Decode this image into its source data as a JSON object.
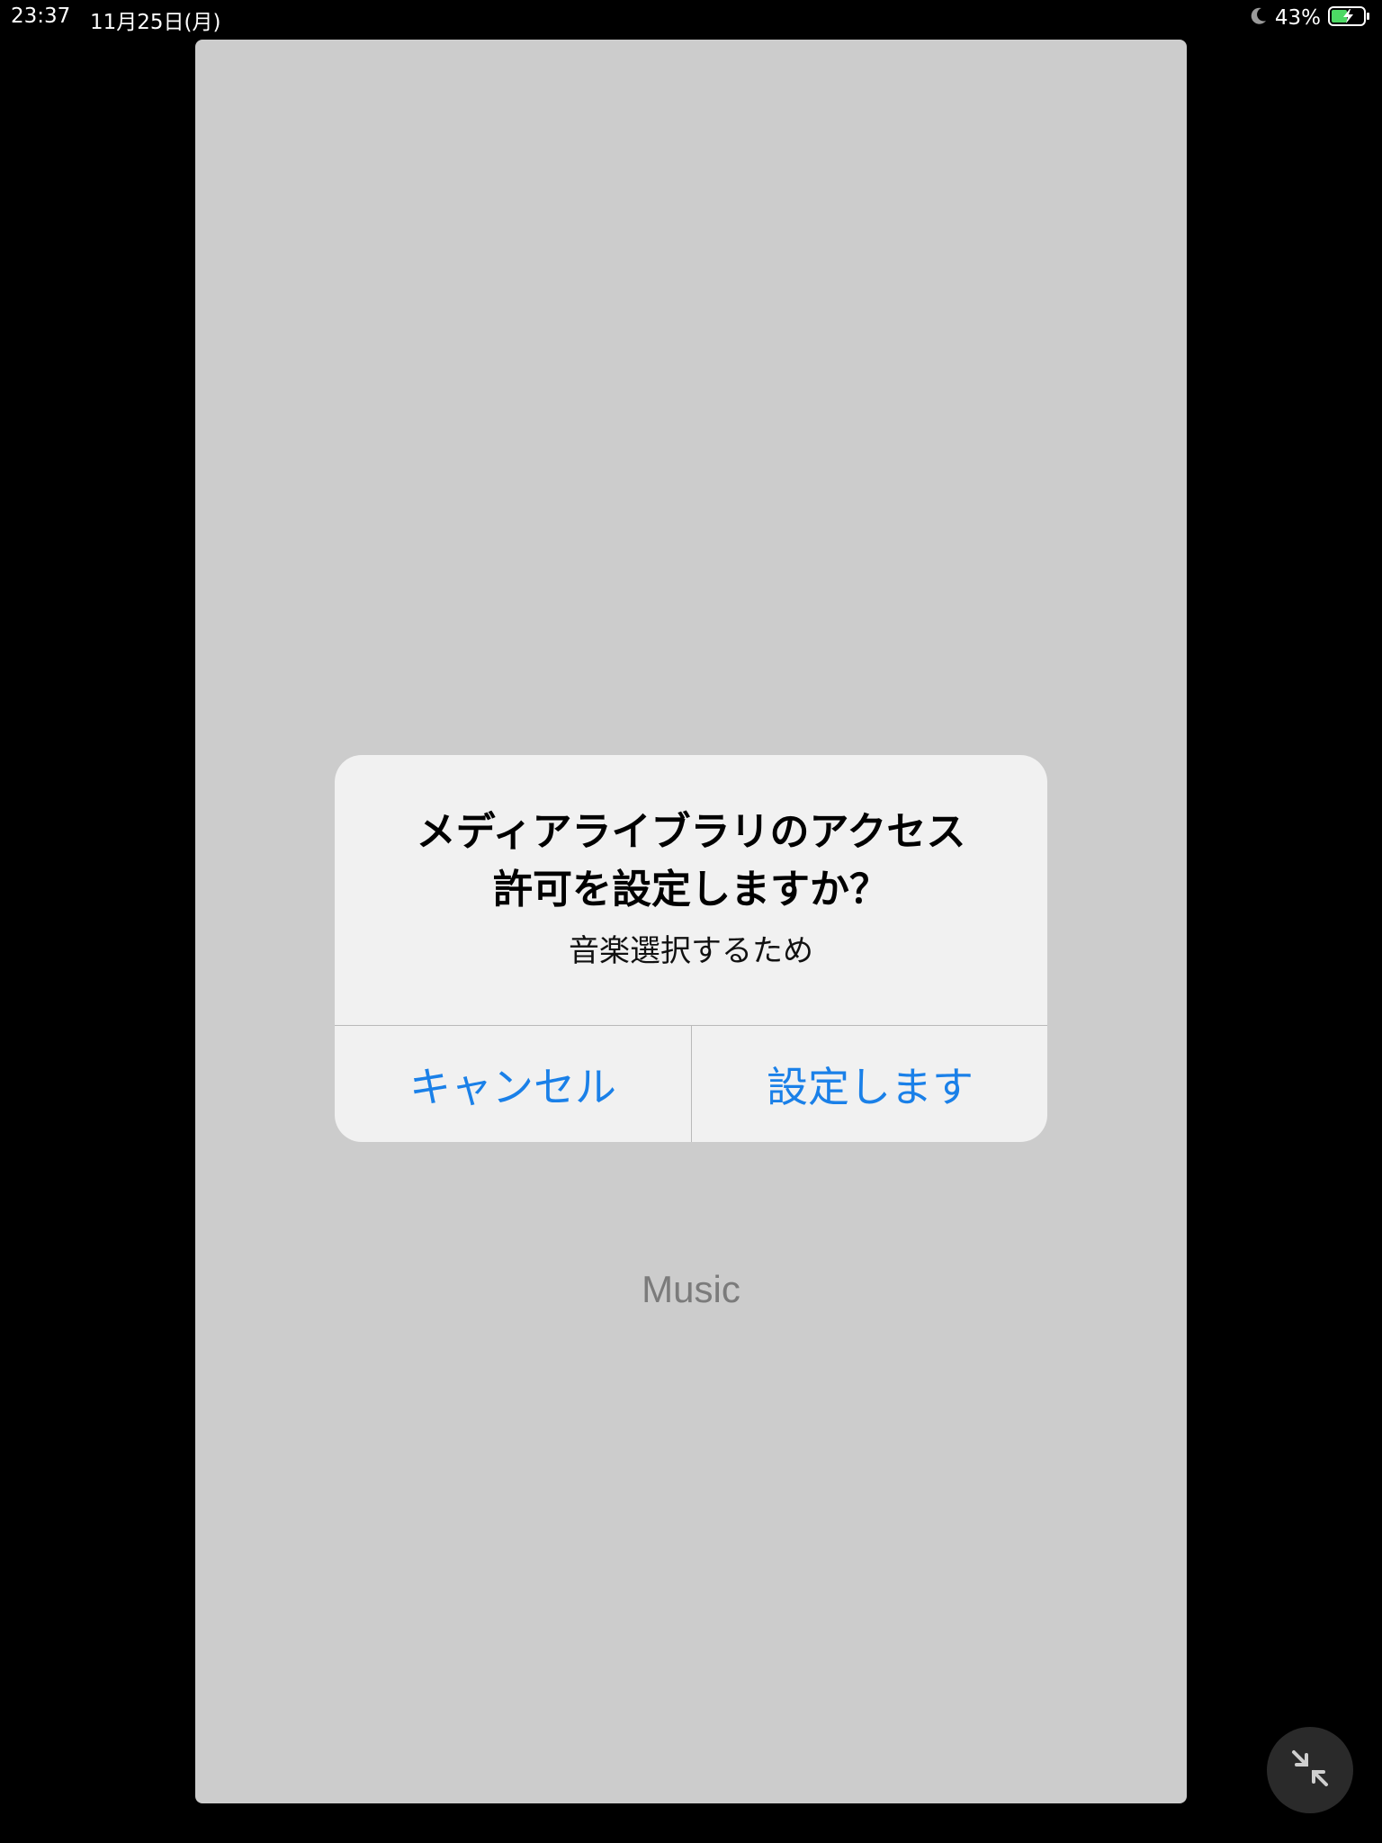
{
  "status_bar": {
    "time": "23:37",
    "date": "11月25日(月)",
    "battery_percent": "43%",
    "icons": [
      "moon-icon",
      "battery-charging-icon"
    ]
  },
  "app": {
    "label": "Music"
  },
  "alert": {
    "title": "メディアライブラリのアクセス許可を設定しますか？",
    "title_line1": "メディアライブラリのアクセス",
    "title_line2": "許可を設定しますか？",
    "message": "音楽選択するため",
    "cancel_label": "キャンセル",
    "confirm_label": "設定します"
  },
  "floating_button": {
    "icon": "collapse-arrows-icon"
  },
  "colors": {
    "background": "#000000",
    "app_background": "#cccccc",
    "alert_background": "#f1f1f1",
    "accent_blue": "#1a80e8",
    "battery_green": "#4cd964"
  }
}
